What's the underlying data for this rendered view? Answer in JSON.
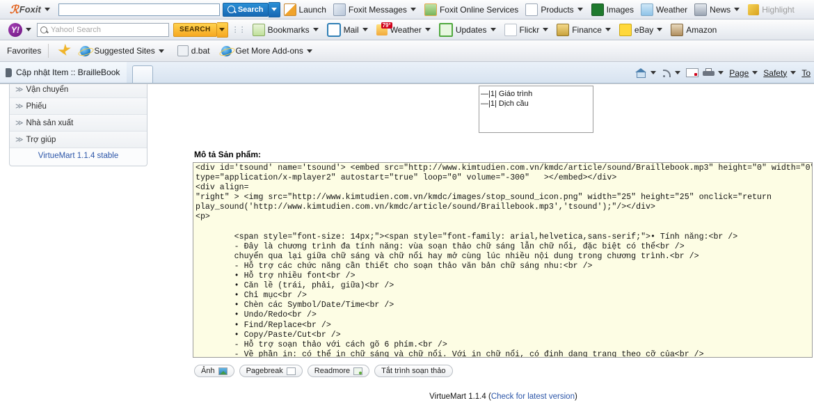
{
  "foxit_toolbar": {
    "brand": "Foxit",
    "search_value": "",
    "search_placeholder": "",
    "search_label": "Search",
    "items": [
      {
        "label": "Launch",
        "icon": "launch-icon",
        "caret": false
      },
      {
        "label": "Foxit Messages",
        "icon": "messages-icon",
        "caret": true
      },
      {
        "label": "Foxit Online Services",
        "icon": "online-services-icon",
        "caret": false
      },
      {
        "label": "Products",
        "icon": "products-icon",
        "caret": true
      },
      {
        "label": "Images",
        "icon": "images-icon",
        "caret": false
      },
      {
        "label": "Weather",
        "icon": "weather-icon",
        "caret": false
      },
      {
        "label": "News",
        "icon": "news-icon",
        "caret": true
      },
      {
        "label": "Highlight",
        "icon": "highlight-icon",
        "caret": false
      }
    ]
  },
  "yahoo_toolbar": {
    "logo": "Y!",
    "search_value": "",
    "search_placeholder": "Yahoo! Search",
    "search_label": "SEARCH",
    "items": [
      {
        "label": "Bookmarks",
        "icon": "bookmarks-icon",
        "caret": true,
        "badge": ""
      },
      {
        "label": "Mail",
        "icon": "mail-icon",
        "caret": true,
        "badge": ""
      },
      {
        "label": "Weather",
        "icon": "weather-icon",
        "caret": true,
        "badge": "79°"
      },
      {
        "label": "Updates",
        "icon": "updates-icon",
        "caret": true,
        "badge": ""
      },
      {
        "label": "Flickr",
        "icon": "flickr-icon",
        "caret": true,
        "badge": ""
      },
      {
        "label": "Finance",
        "icon": "finance-icon",
        "caret": true,
        "badge": ""
      },
      {
        "label": "eBay",
        "icon": "ebay-icon",
        "caret": true,
        "badge": ""
      },
      {
        "label": "Amazon",
        "icon": "amazon-icon",
        "caret": false,
        "badge": ""
      }
    ]
  },
  "favorites_bar": {
    "favorites_label": "Favorites",
    "items": [
      {
        "label": "Suggested Sites",
        "icon": "ie-icon",
        "caret": true
      },
      {
        "label": "d.bat",
        "icon": "script-icon",
        "caret": false
      },
      {
        "label": "Get More Add-ons",
        "icon": "ie-icon",
        "caret": true
      }
    ]
  },
  "tab_strip": {
    "tab_title": "Cập nhật Item :: BrailleBook",
    "new_tab_label": "",
    "command_items": [
      {
        "label": "",
        "icon": "home-icon",
        "caret": true
      },
      {
        "label": "",
        "icon": "rss-feed-icon",
        "caret": true
      },
      {
        "label": "",
        "icon": "read-mail-icon",
        "caret": false
      },
      {
        "label": "",
        "icon": "print-icon",
        "caret": true
      },
      {
        "label": "Page",
        "icon": "",
        "caret": true
      },
      {
        "label": "Safety",
        "icon": "",
        "caret": true
      },
      {
        "label": "To",
        "icon": "",
        "caret": false
      }
    ]
  },
  "sidebar": {
    "items": [
      {
        "label": "Vận chuyển"
      },
      {
        "label": "Phiếu"
      },
      {
        "label": "Nhà sản xuất"
      },
      {
        "label": "Trợ giúp"
      }
    ],
    "version_link": "VirtueMart 1.1.4 stable"
  },
  "tree_box": {
    "rows": [
      "—|1| Giáo trình",
      "—|1| Dịch cầu"
    ]
  },
  "editor": {
    "description_label": "Mô tả Sản phẩm:",
    "code": "<div id='tsound' name='tsound'> <embed src=\"http://www.kimtudien.com.vn/kmdc/article/sound/Braillebook.mp3\" height=\"0\" width=\"0\"\ntype=\"application/x-mplayer2\" autostart=\"true\" loop=\"0\" volume=\"-300\"   ></embed></div>\n<div align=\n\"right\" > <img src=\"http://www.kimtudien.com.vn/kmdc/images/stop_sound_icon.png\" width=\"25\" height=\"25\" onclick=\"return\nplay_sound('http://www.kimtudien.com.vn/kmdc/article/sound/Braillebook.mp3','tsound');\"/></div>\n<p>\n\n        <span style=\"font-size: 14px;\"><span style=\"font-family: arial,helvetica,sans-serif;\">• Tính năng:<br />\n        - Đây là chương trình đa tính năng: vùa soạn thảo chữ sáng lẫn chữ nổi, đặc biệt có thể<br />\n        chuyển qua lại giữa chữ sáng và chữ nổi hay mở cùng lúc nhiều nội dung trong chương trình.<br />\n        - Hỗ trợ các chức năng cần thiết cho soạn thảo văn bản chữ sáng nhu:<br />\n        • Hỗ trợ nhiều font<br />\n        • Căn lề (trái, phải, giữa)<br />\n        • Chỉ mục<br />\n        • Chèn các Symbol/Date/Time<br />\n        • Undo/Redo<br />\n        • Find/Replace<br />\n        • Copy/Paste/Cut<br />\n        - Hỗ trợ soạn thảo với cách gõ 6 phím.<br />\n        - Về phần in: có thể in chữ sáng và chữ nổi. Với in chữ nổi, có định dạng trang theo cỡ của<br />\n        máy in chữ nổi đang sử dụng.</span></span></p>",
    "buttons": [
      {
        "label": "Ảnh",
        "icon": "image-icon"
      },
      {
        "label": "Pagebreak",
        "icon": "pagebreak-icon"
      },
      {
        "label": "Readmore",
        "icon": "readmore-icon"
      },
      {
        "label": "Tắt trình soạn thảo",
        "icon": ""
      }
    ]
  },
  "footer": {
    "version_text": "VirtueMart 1.1.4 (",
    "link_text": "Check for latest version",
    "version_close": ")"
  },
  "colors": {
    "code_bg": "#fdfde4",
    "accent_blue": "#1768b4",
    "accent_orange": "#f6a821",
    "link": "#2b55a8"
  }
}
